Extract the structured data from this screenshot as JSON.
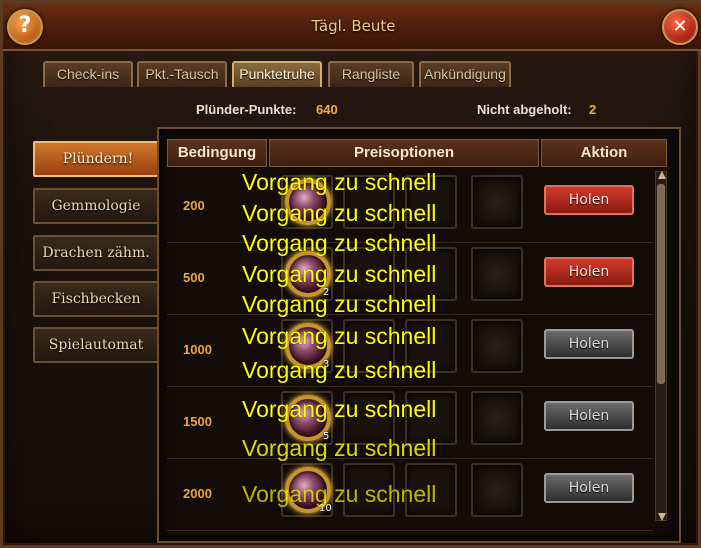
{
  "window": {
    "title": "Tägl. Beute",
    "help_icon": "?",
    "close_icon": "✕"
  },
  "tabs": [
    {
      "label": "Check-ins"
    },
    {
      "label": "Pkt.-Tausch"
    },
    {
      "label": "Punktetruhe",
      "active": true
    },
    {
      "label": "Rangliste"
    },
    {
      "label": "Ankündigung"
    }
  ],
  "points": {
    "label": "Plünder-Punkte:",
    "value": "640",
    "unclaimed_label": "Nicht abgeholt:",
    "unclaimed_value": "2"
  },
  "sidebar": [
    {
      "label": "Plündern!",
      "active": true
    },
    {
      "label": "Gemmologie"
    },
    {
      "label": "Drachen zähm."
    },
    {
      "label": "Fischbecken"
    },
    {
      "label": "Spielautomat"
    }
  ],
  "table": {
    "headers": {
      "condition": "Bedingung",
      "rewards": "Preisoptionen",
      "action": "Aktion"
    },
    "rows": [
      {
        "condition": "200",
        "qty": "",
        "button": "Holen",
        "button_state": "active"
      },
      {
        "condition": "500",
        "qty": "2",
        "button": "Holen",
        "button_state": "active"
      },
      {
        "condition": "1000",
        "qty": "3",
        "button": "Holen",
        "button_state": "disabled"
      },
      {
        "condition": "1500",
        "qty": "5",
        "button": "Holen",
        "button_state": "disabled"
      },
      {
        "condition": "2000",
        "qty": "10",
        "button": "Holen",
        "button_state": "disabled"
      }
    ]
  },
  "overlay_messages": [
    "Vorgang zu schnell",
    "Vorgang zu schnell",
    "Vorgang zu schnell",
    "Vorgang zu schnell",
    "Vorgang zu schnell",
    "Vorgang zu schnell",
    "Vorgang zu schnell",
    "Vorgang zu schnell",
    "Vorgang zu schnell",
    "Vorgang zu schnell",
    "Vorgang zu schnell"
  ],
  "colors": {
    "accent_gold": "#f0a43a",
    "overlay_text": "#ffff00",
    "button_red": "#c0301e",
    "button_grey": "#555555"
  }
}
